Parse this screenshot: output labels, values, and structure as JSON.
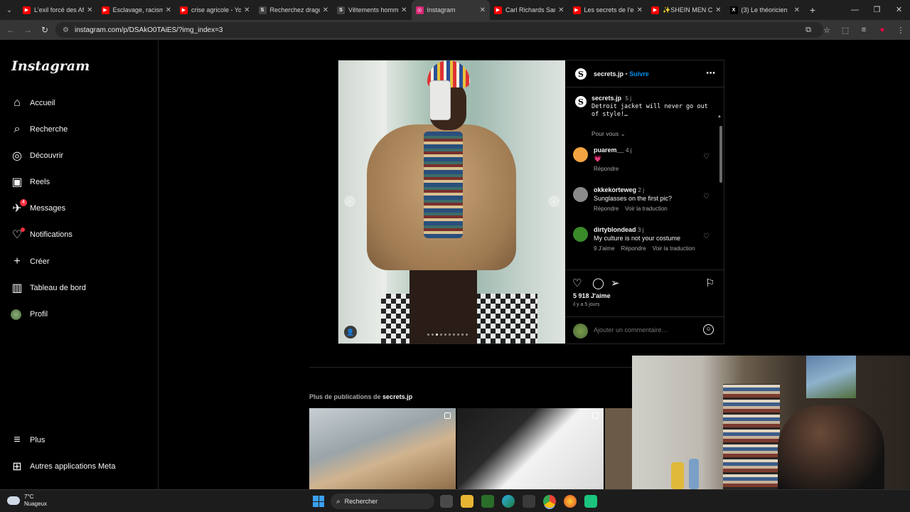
{
  "browser": {
    "tabs": [
      {
        "title": "L'exil forcé des Af",
        "favicon": "youtube",
        "color": "#ff0000",
        "active": false
      },
      {
        "title": "Esclavage, racism",
        "favicon": "youtube",
        "color": "#ff0000",
        "active": false
      },
      {
        "title": "crise agricole - Yo",
        "favicon": "youtube",
        "color": "#ff0000",
        "active": false
      },
      {
        "title": "Recherchez drago",
        "favicon": "S",
        "color": "#444444",
        "active": false
      },
      {
        "title": "Vêtements homm",
        "favicon": "S",
        "color": "#444444",
        "active": false
      },
      {
        "title": "Instagram",
        "favicon": "instagram",
        "color": "#d62976",
        "active": true
      },
      {
        "title": "Carl Richards Sam",
        "favicon": "youtube",
        "color": "#ff0000",
        "active": false
      },
      {
        "title": "Les secrets de l'er",
        "favicon": "youtube",
        "color": "#ff0000",
        "active": false
      },
      {
        "title": "✨SHEIN MEN C",
        "favicon": "youtube",
        "color": "#ff0000",
        "active": false
      },
      {
        "title": "(3) Le théoricien",
        "favicon": "X",
        "color": "#000000",
        "active": false
      }
    ],
    "new_tab": "+",
    "url": "instagram.com/p/DSAkO0TAiES/?img_index=3"
  },
  "sidebar": {
    "logo": "Instagram",
    "items": [
      {
        "label": "Accueil",
        "icon": "home-icon"
      },
      {
        "label": "Recherche",
        "icon": "search-icon"
      },
      {
        "label": "Découvrir",
        "icon": "compass-icon"
      },
      {
        "label": "Reels",
        "icon": "reels-icon"
      },
      {
        "label": "Messages",
        "icon": "messenger-icon",
        "badge": "4"
      },
      {
        "label": "Notifications",
        "icon": "heart-icon",
        "dot": true
      },
      {
        "label": "Créer",
        "icon": "plus-icon"
      },
      {
        "label": "Tableau de bord",
        "icon": "dashboard-icon"
      },
      {
        "label": "Profil",
        "icon": "profile-avatar"
      }
    ],
    "bottom_items": [
      {
        "label": "Plus",
        "icon": "menu-icon"
      },
      {
        "label": "Autres applications Meta",
        "icon": "meta-apps-icon"
      }
    ]
  },
  "post": {
    "author": "secrets.jp",
    "follow_sep": "•",
    "follow_label": "Suivre",
    "caption": {
      "username": "secrets.jp",
      "time": "5 j",
      "text_line1": "Detroit jacket will never go out",
      "text_line2": "of style!…"
    },
    "pour_vous": "Pour vous",
    "comments": [
      {
        "username": "puarem__",
        "time": "4 j",
        "text": "💗",
        "actions": [
          "Répondre"
        ],
        "avatar_color": "#f2a541"
      },
      {
        "username": "okkekorteweg",
        "time": "2 j",
        "text": "Sunglasses on the first pic?",
        "actions": [
          "Répondre",
          "Voir la traduction"
        ],
        "avatar_color": "#8a8a8a"
      },
      {
        "username": "dirtyblondead",
        "time": "3 j",
        "text": "My culture is not your costume",
        "actions": [
          "9 J'aime",
          "Répondre",
          "Voir la traduction"
        ],
        "avatar_color": "#3a8a2a"
      }
    ],
    "likes": "5 918 J'aime",
    "date": "il y a 5 jours",
    "comment_placeholder": "Ajouter un commentaire…",
    "carousel_dots": 10,
    "carousel_active_index": 2
  },
  "more": {
    "prefix": "Plus de publications de",
    "username": "secrets.jp"
  },
  "taskbar": {
    "temperature": "7°C",
    "weather": "Nuageux",
    "search_label": "Rechercher"
  }
}
